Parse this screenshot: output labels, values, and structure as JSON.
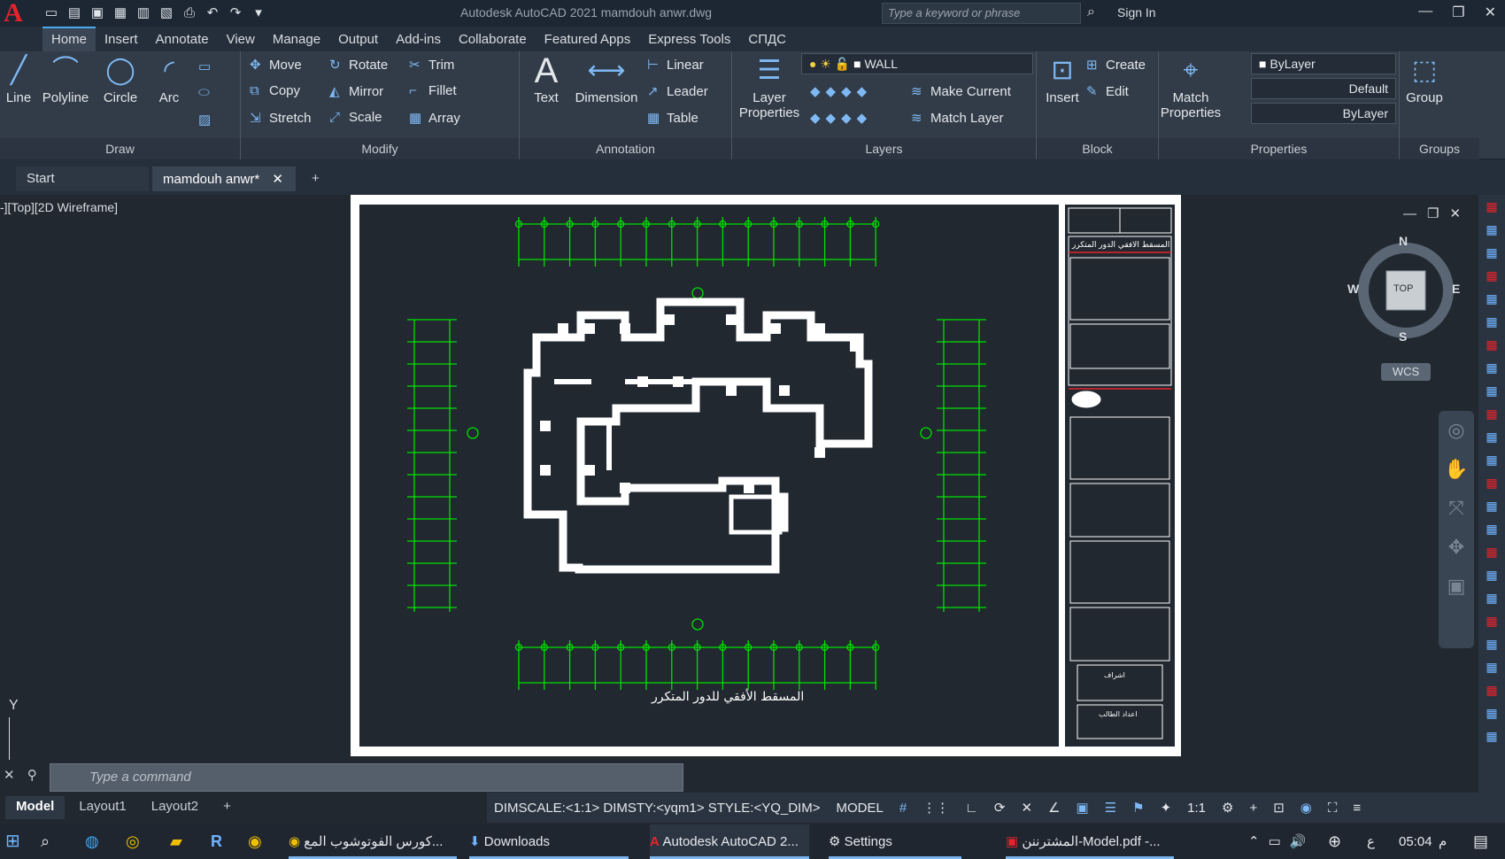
{
  "app": {
    "title": "Autodesk AutoCAD 2021    mamdouh anwr.dwg",
    "search_placeholder": "Type a keyword or phrase",
    "sign_in": "Sign In"
  },
  "ribbon_tabs": [
    "Home",
    "Insert",
    "Annotate",
    "View",
    "Manage",
    "Output",
    "Add-ins",
    "Collaborate",
    "Featured Apps",
    "Express Tools",
    "СПДС"
  ],
  "draw": {
    "title": "Draw",
    "line": "Line",
    "polyline": "Polyline",
    "circle": "Circle",
    "arc": "Arc"
  },
  "modify": {
    "title": "Modify",
    "move": "Move",
    "rotate": "Rotate",
    "trim": "Trim",
    "copy": "Copy",
    "mirror": "Mirror",
    "fillet": "Fillet",
    "stretch": "Stretch",
    "scale": "Scale",
    "array": "Array"
  },
  "annotation": {
    "title": "Annotation",
    "text": "Text",
    "dimension": "Dimension",
    "linear": "Linear",
    "leader": "Leader",
    "table": "Table"
  },
  "layers": {
    "title": "Layers",
    "layer_properties": "Layer Properties",
    "current_layer": "WALL",
    "make_current": "Make Current",
    "match_layer": "Match Layer"
  },
  "block": {
    "title": "Block",
    "insert": "Insert",
    "create": "Create",
    "edit": "Edit"
  },
  "properties": {
    "title": "Properties",
    "match_properties": "Match Properties",
    "color": "ByLayer",
    "lineweight": "Default",
    "linetype": "ByLayer"
  },
  "groups": {
    "title": "Groups",
    "group": "Group"
  },
  "doc_tabs": {
    "start": "Start",
    "file": "mamdouh anwr*"
  },
  "viewport": {
    "label": "-][Top][2D Wireframe]",
    "compass_n": "N",
    "compass_s": "S",
    "compass_e": "E",
    "compass_w": "W",
    "compass_top": "TOP",
    "wcs": "WCS",
    "ucs_y": "Y"
  },
  "drawing": {
    "caption": "المسقط الأفقي للدور المتكرر",
    "title_block_heading": "المسقط الافقي الدور المتكرر",
    "supervisor": "اشراف",
    "student": "اعداد الطالب"
  },
  "command": {
    "placeholder": "Type a command"
  },
  "layout_tabs": [
    "Model",
    "Layout1",
    "Layout2"
  ],
  "status": {
    "dimscale": "DIMSCALE:<1:1> DIMSTY:<yqm1> STYLE:<YQ_DIM>",
    "model": "MODEL",
    "scale": "1:1"
  },
  "taskbar": {
    "chrome_task": "كورس الفوتوشوب المع...",
    "downloads": "Downloads",
    "autocad": "Autodesk AutoCAD 2...",
    "settings": "Settings",
    "pdf": "المشترننن-Model.pdf -...",
    "time": "05:04",
    "ampm": "م",
    "lang": "ع"
  },
  "colors": {
    "accent": "#4aa8ef",
    "grid": "#00e000",
    "logo": "#e5232b"
  }
}
